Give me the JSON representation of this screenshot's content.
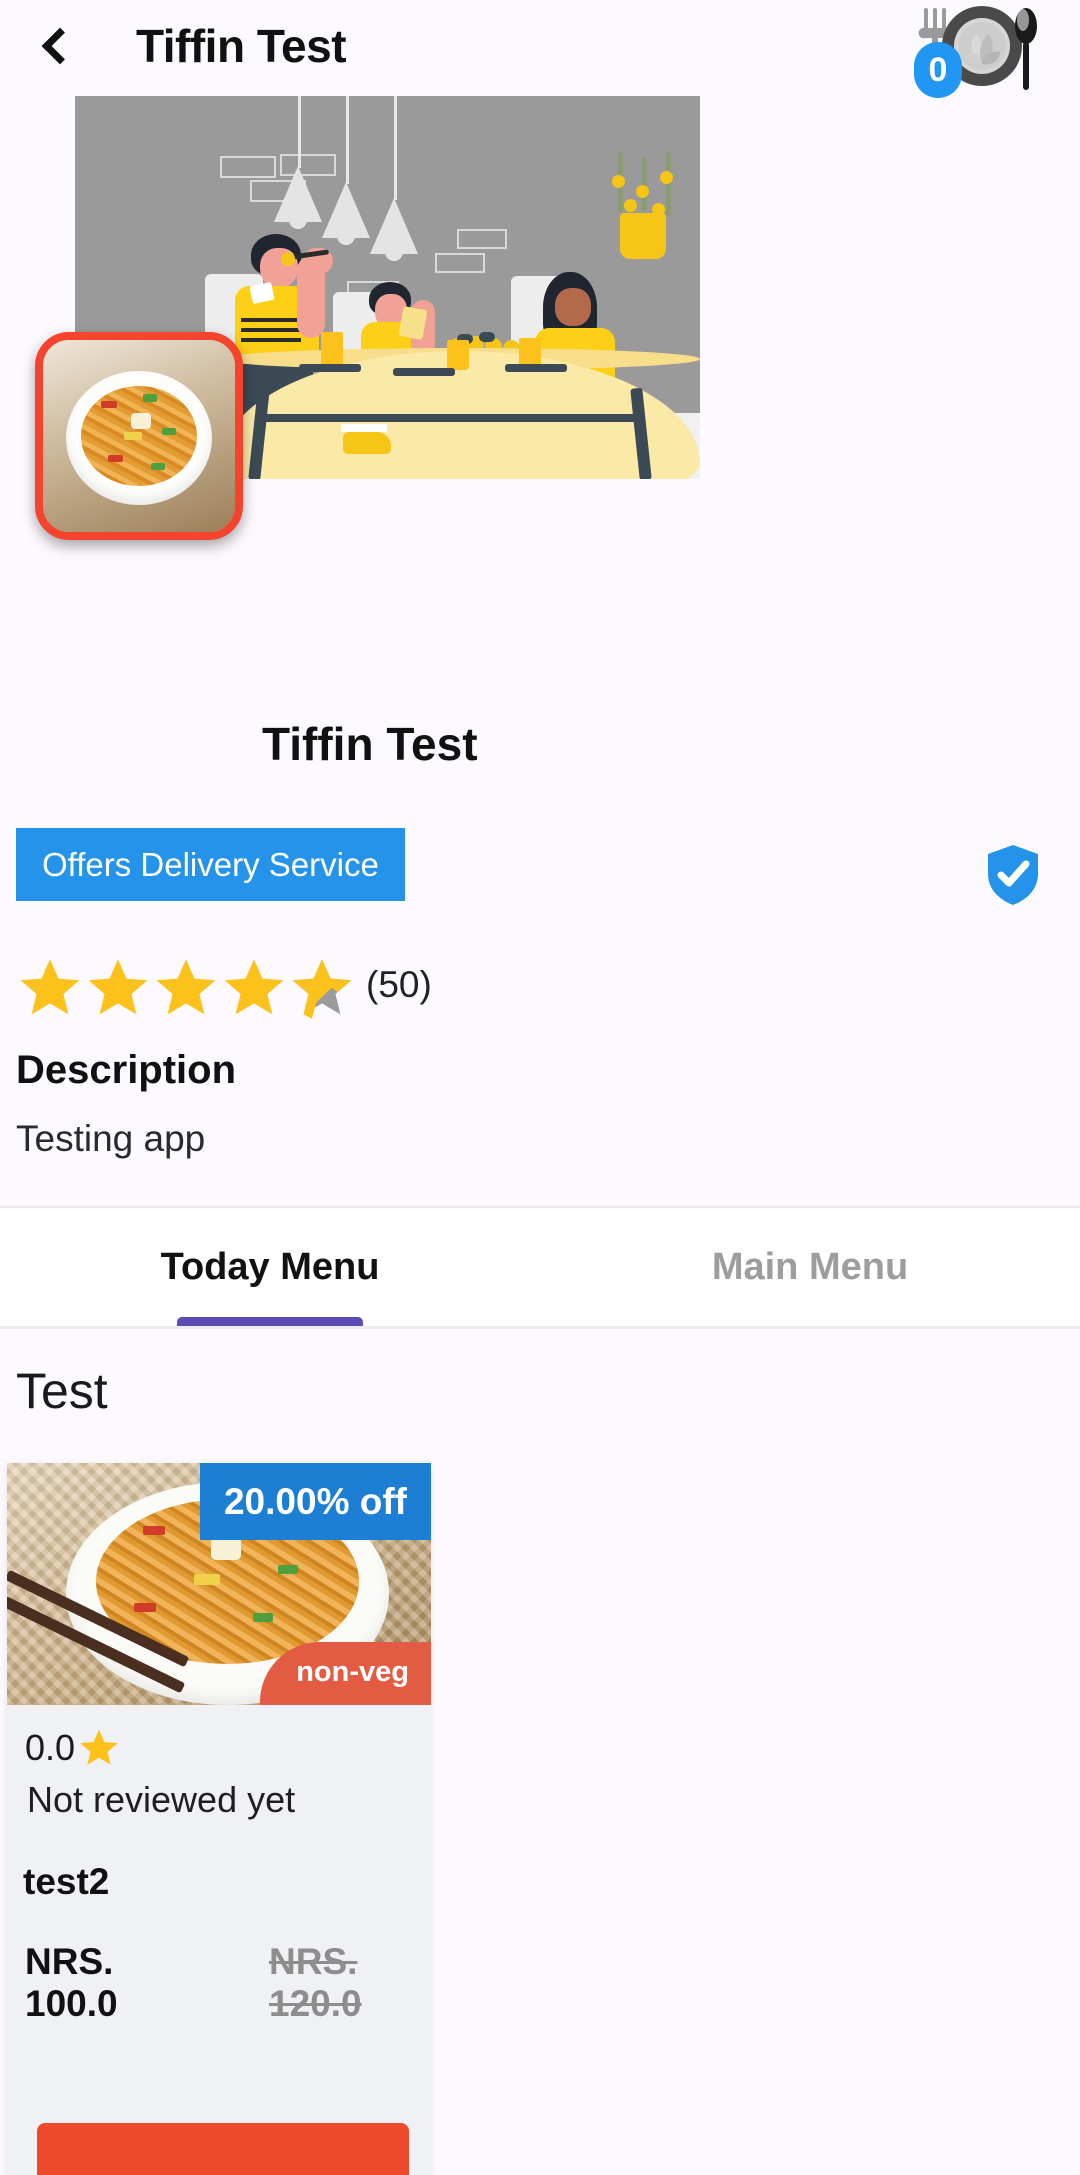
{
  "appbar": {
    "back_icon": "back-chevron-icon",
    "title": "Tiffin Test",
    "cart_icon": "plate-fork-spoon-icon",
    "cart_count": "0",
    "cart_badge_color": "#2196f3"
  },
  "banner": {
    "image_alt": "family-dining-illustration",
    "background_color": "#9a9a9a"
  },
  "restaurant": {
    "logo_alt": "noodles-logo-thumbnail",
    "logo_border_color": "#f4442e",
    "name": "Tiffin Test",
    "delivery_badge": "Offers Delivery Service",
    "delivery_badge_color": "#2693ea",
    "verified_icon": "verified-shield-icon",
    "verified_color": "#2693ea",
    "rating_stars": 5,
    "star_color": "#fcc21b",
    "rating_count": "(50)"
  },
  "description": {
    "heading": "Description",
    "text": "Testing app"
  },
  "tabs": {
    "items": [
      {
        "label": "Today Menu",
        "active": true
      },
      {
        "label": "Main Menu",
        "active": false
      }
    ],
    "indicator_color": "#5b4bb5"
  },
  "menu": {
    "section_title": "Test",
    "cards": [
      {
        "image_alt": "noodles-dish-photo",
        "discount": "20.00% off",
        "discount_color": "#1d7fd4",
        "diet_tag": "non-veg",
        "diet_tag_color": "#e35b43",
        "rating_value": "0.0",
        "rating_text": "Not reviewed yet",
        "name": "test2",
        "price_current": "NRS. 100.0",
        "price_original": "NRS. 120.0",
        "action_color": "#ef4a2c"
      }
    ]
  }
}
